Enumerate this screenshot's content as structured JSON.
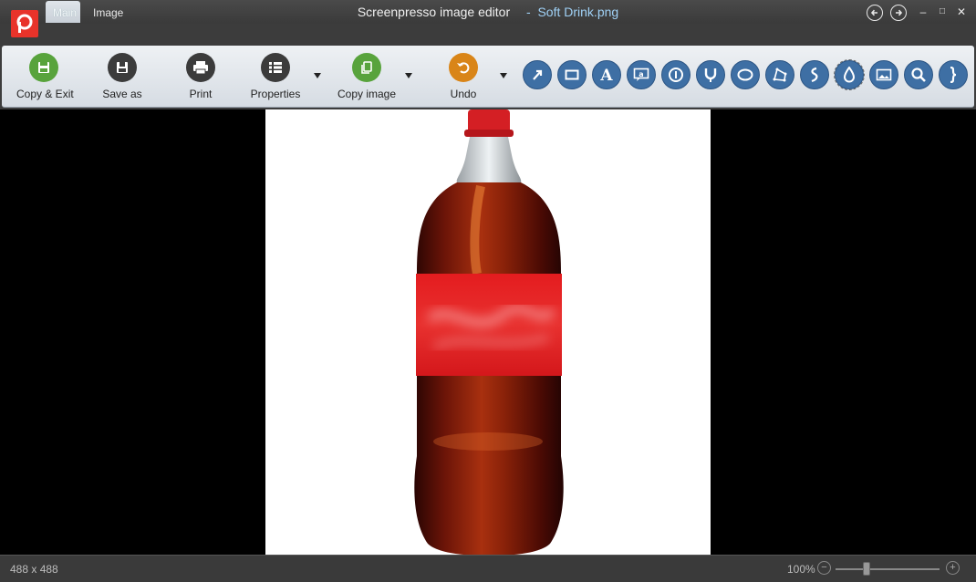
{
  "window": {
    "app_title": "Screenpresso image editor",
    "separator": "-",
    "file_name": "Soft Drink.png"
  },
  "title_controls": {
    "back_icon": "arrow-left-circle-icon",
    "forward_icon": "arrow-right-circle-icon",
    "minimize": "–",
    "maximize": "□",
    "close": "✕"
  },
  "tabs": [
    {
      "label": "Main",
      "active": true
    },
    {
      "label": "Image",
      "active": false
    }
  ],
  "ribbon": {
    "copy_exit": "Copy & Exit",
    "save_as": "Save as",
    "print": "Print",
    "properties": "Properties",
    "copy_image": "Copy image",
    "undo": "Undo"
  },
  "tools": [
    "arrow-tool-icon",
    "rectangle-tool-icon",
    "text-tool-icon",
    "callout-tool-icon",
    "numbered-step-tool-icon",
    "magnet-tool-icon",
    "ellipse-tool-icon",
    "polygon-tool-icon",
    "freehand-tool-icon",
    "blur-drop-tool-icon",
    "image-insert-tool-icon",
    "magnifier-tool-icon",
    "brace-tool-icon"
  ],
  "colors": {
    "accent_green": "#58a33c",
    "accent_orange": "#d98518",
    "tool_blue": "#3e6fa4",
    "logo_red": "#e8332a",
    "filename_blue": "#9fd0f5"
  },
  "status": {
    "image_size": "488 x 488",
    "zoom": "100%",
    "zoom_level": 1.0
  }
}
